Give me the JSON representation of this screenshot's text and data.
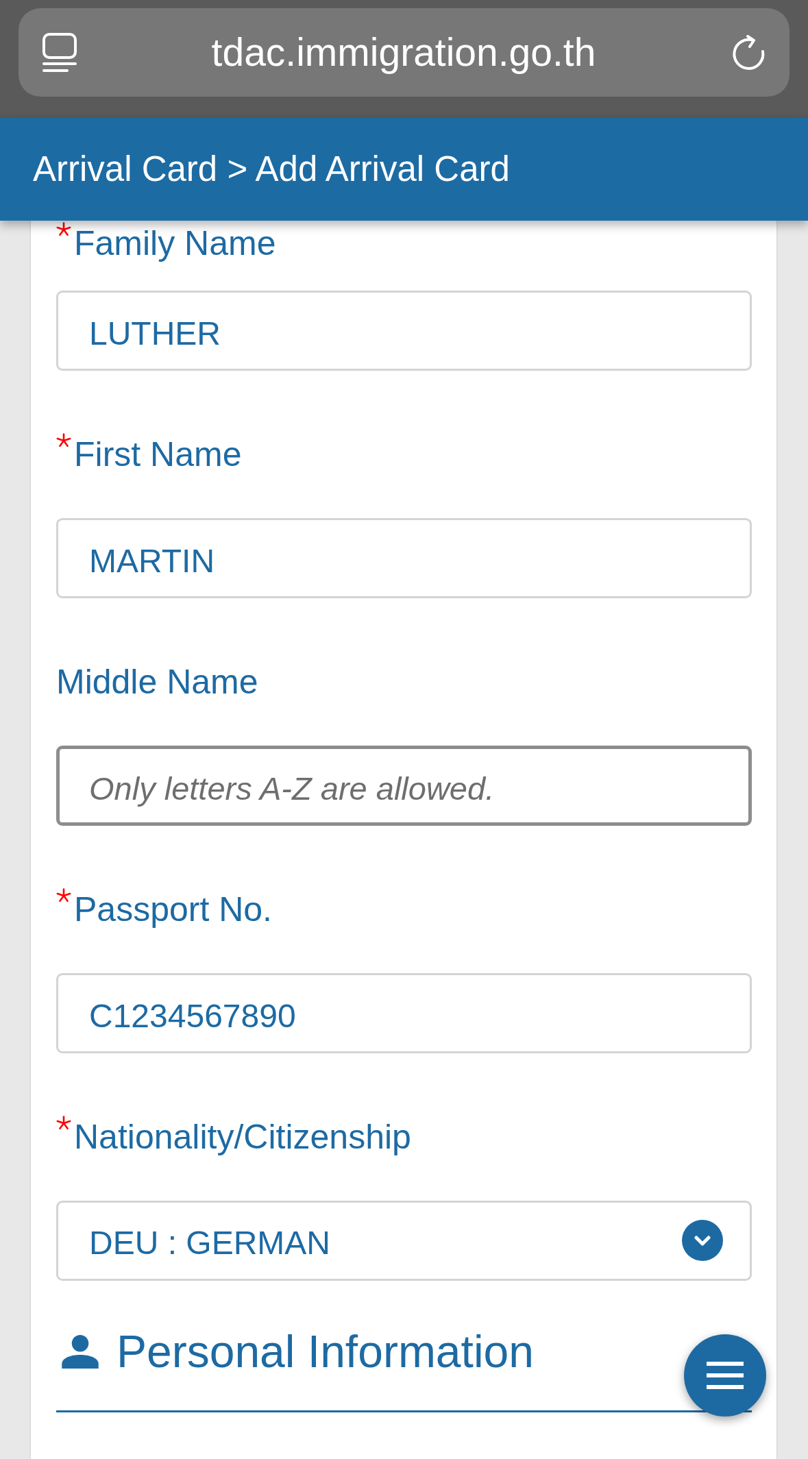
{
  "browser_bar": {
    "url": "tdac.immigration.go.th"
  },
  "header": {
    "title": "Arrival Card > Add Arrival Card"
  },
  "form": {
    "fields": [
      {
        "kind": "text",
        "label": "Family Name",
        "required": true,
        "value": "LUTHER",
        "focused": false
      },
      {
        "kind": "text",
        "label": "First Name",
        "required": true,
        "value": "MARTIN",
        "focused": false
      },
      {
        "kind": "text",
        "label": "Middle Name",
        "required": false,
        "placeholder": "Only letters A-Z are allowed.",
        "focused": true
      },
      {
        "kind": "text",
        "label": "Passport No.",
        "required": true,
        "value": "C1234567890",
        "focused": false
      },
      {
        "kind": "select",
        "label": "Nationality/Citizenship",
        "required": true,
        "value": "DEU : GERMAN",
        "focused": false
      }
    ],
    "section": {
      "title": "Personal Information"
    }
  }
}
